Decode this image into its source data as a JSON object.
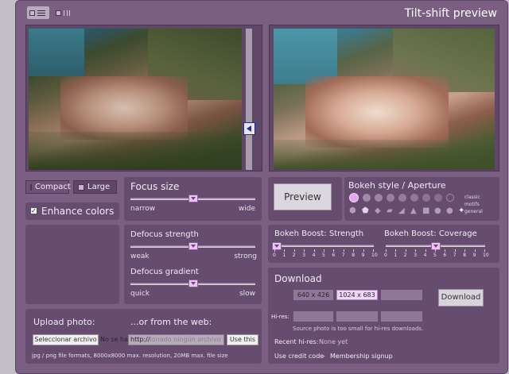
{
  "header": {
    "title": "Tilt-shift preview"
  },
  "size_buttons": {
    "compact": "Compact",
    "large": "Large"
  },
  "enhance": {
    "label": "Enhance colors",
    "checked": true
  },
  "focus": {
    "title": "Focus size",
    "left": "narrow",
    "right": "wide",
    "value": 0.5
  },
  "preview": {
    "label": "Preview"
  },
  "bokeh_style": {
    "title": "Bokeh style / Aperture",
    "legend": [
      "classic",
      "motifs",
      "general"
    ]
  },
  "defocus_strength": {
    "title": "Defocus strength",
    "left": "weak",
    "right": "strong",
    "value": 0.5
  },
  "defocus_gradient": {
    "title": "Defocus gradient",
    "left": "quick",
    "right": "slow",
    "value": 0.5
  },
  "bokeh_strength": {
    "title": "Bokeh Boost: Strength",
    "value": 0,
    "ticks": [
      "0",
      "1",
      "2",
      "3",
      "4",
      "5",
      "6",
      "7",
      "8",
      "9",
      "10"
    ]
  },
  "bokeh_coverage": {
    "title": "Bokeh Boost: Coverage",
    "value": 5,
    "ticks": [
      "0",
      "1",
      "2",
      "3",
      "4",
      "5",
      "6",
      "7",
      "8",
      "9",
      "10"
    ]
  },
  "download": {
    "title": "Download",
    "sizes": [
      "640 x 426",
      "1024 x 683",
      ""
    ],
    "button": "Download",
    "hires_label": "Hi-res:",
    "hires_note": "Source photo is too small for hi-res downloads.",
    "recent_label": "Recent hi-res:",
    "recent_value": "None yet",
    "credit": "Use credit code",
    "sep": "-",
    "membership": "Membership signup"
  },
  "upload": {
    "title": "Upload photo:",
    "file_button": "Seleccionar archivo",
    "file_status": "No se ha",
    "web_title": "...or from the web:",
    "url_value": "http://",
    "url_placeholder": "ionado ningún archivo",
    "use_button": "Use this",
    "note": "jpg / png file formats, 8000x8000 max. resolution, 20MB max. file size"
  }
}
